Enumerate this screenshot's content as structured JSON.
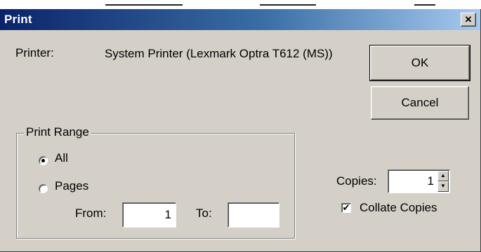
{
  "window": {
    "title": "Print",
    "close_glyph": "×"
  },
  "printer": {
    "label": "Printer:",
    "name": "System Printer (Lexmark Optra T612 (MS))"
  },
  "buttons": {
    "ok_label": "OK",
    "cancel_label": "Cancel"
  },
  "print_range": {
    "legend": "Print Range",
    "all_label": "All",
    "pages_label": "Pages",
    "selected": "All",
    "from_label": "From:",
    "from_value": "1",
    "to_label": "To:",
    "to_value": ""
  },
  "copies": {
    "label": "Copies:",
    "value": "1",
    "spin_up_glyph": "▲",
    "spin_down_glyph": "▼"
  },
  "collate": {
    "label": "Collate Copies",
    "checked": true,
    "check_glyph": "✔"
  },
  "icons": {
    "close": "close-icon",
    "spin_up": "spin-up-icon",
    "spin_down": "spin-down-icon",
    "radio": "radio-icon",
    "checkbox": "checkbox-icon"
  },
  "colors": {
    "dialog_face": "#d4d0c8",
    "titlebar_start": "#0a246a",
    "titlebar_end": "#a6caf0",
    "title_text": "#ffffff"
  }
}
